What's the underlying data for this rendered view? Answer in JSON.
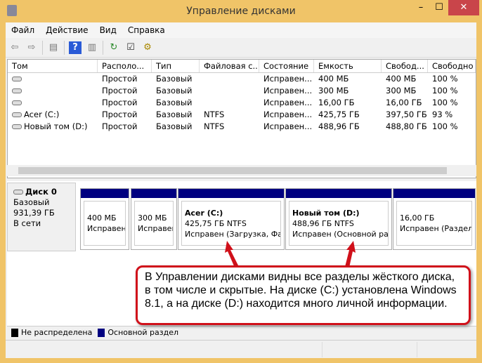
{
  "window": {
    "title": "Управление дисками",
    "minimize": "–",
    "maximize": "☐",
    "close": "✕",
    "close_color": "#c9454a"
  },
  "menu": [
    "Файл",
    "Действие",
    "Вид",
    "Справка"
  ],
  "toolbar": [
    "back-icon",
    "forward-icon",
    "console-tree-icon",
    "help-icon",
    "action-pane-icon",
    "refresh-icon",
    "properties-icon",
    "settings-icon"
  ],
  "table": {
    "columns": [
      "Том",
      "Располо...",
      "Тип",
      "Файловая с...",
      "Состояние",
      "Емкость",
      "Свобод...",
      "Свободно %"
    ],
    "rows": [
      [
        "",
        "Простой",
        "Базовый",
        "",
        "Исправен...",
        "400 МБ",
        "400 МБ",
        "100 %"
      ],
      [
        "",
        "Простой",
        "Базовый",
        "",
        "Исправен...",
        "300 МБ",
        "300 МБ",
        "100 %"
      ],
      [
        "",
        "Простой",
        "Базовый",
        "",
        "Исправен...",
        "16,00 ГБ",
        "16,00 ГБ",
        "100 %"
      ],
      [
        "Acer (C:)",
        "Простой",
        "Базовый",
        "NTFS",
        "Исправен...",
        "425,75 ГБ",
        "397,50 ГБ",
        "93 %"
      ],
      [
        "Новый том (D:)",
        "Простой",
        "Базовый",
        "NTFS",
        "Исправен...",
        "488,96 ГБ",
        "488,80 ГБ",
        "100 %"
      ]
    ]
  },
  "disk": {
    "name": "Диск 0",
    "type": "Базовый",
    "size": "931,39 ГБ",
    "status": "В сети",
    "partitions": [
      {
        "title": "",
        "line1": "400 МБ",
        "line2": "Исправен"
      },
      {
        "title": "",
        "line1": "300 МБ",
        "line2": "Исправен"
      },
      {
        "title": "Acer  (C:)",
        "line1": "425,75 ГБ NTFS",
        "line2": "Исправен (Загрузка, Фай"
      },
      {
        "title": "Новый том  (D:)",
        "line1": "488,96 ГБ NTFS",
        "line2": "Исправен (Основной раз"
      },
      {
        "title": "",
        "line1": "16,00 ГБ",
        "line2": "Исправен (Раздел"
      }
    ]
  },
  "legend": [
    {
      "label": "Не распределена",
      "color": "#000000"
    },
    {
      "label": "Основной раздел",
      "color": "#000080"
    }
  ],
  "callout": {
    "text": "В Управлении дисками видны все разделы жёсткого диска, в том числе и скрытые. На диске (C:) установлена Windows 8.1, а на диске (D:) находится много личной информации.",
    "color": "#d0101a"
  }
}
